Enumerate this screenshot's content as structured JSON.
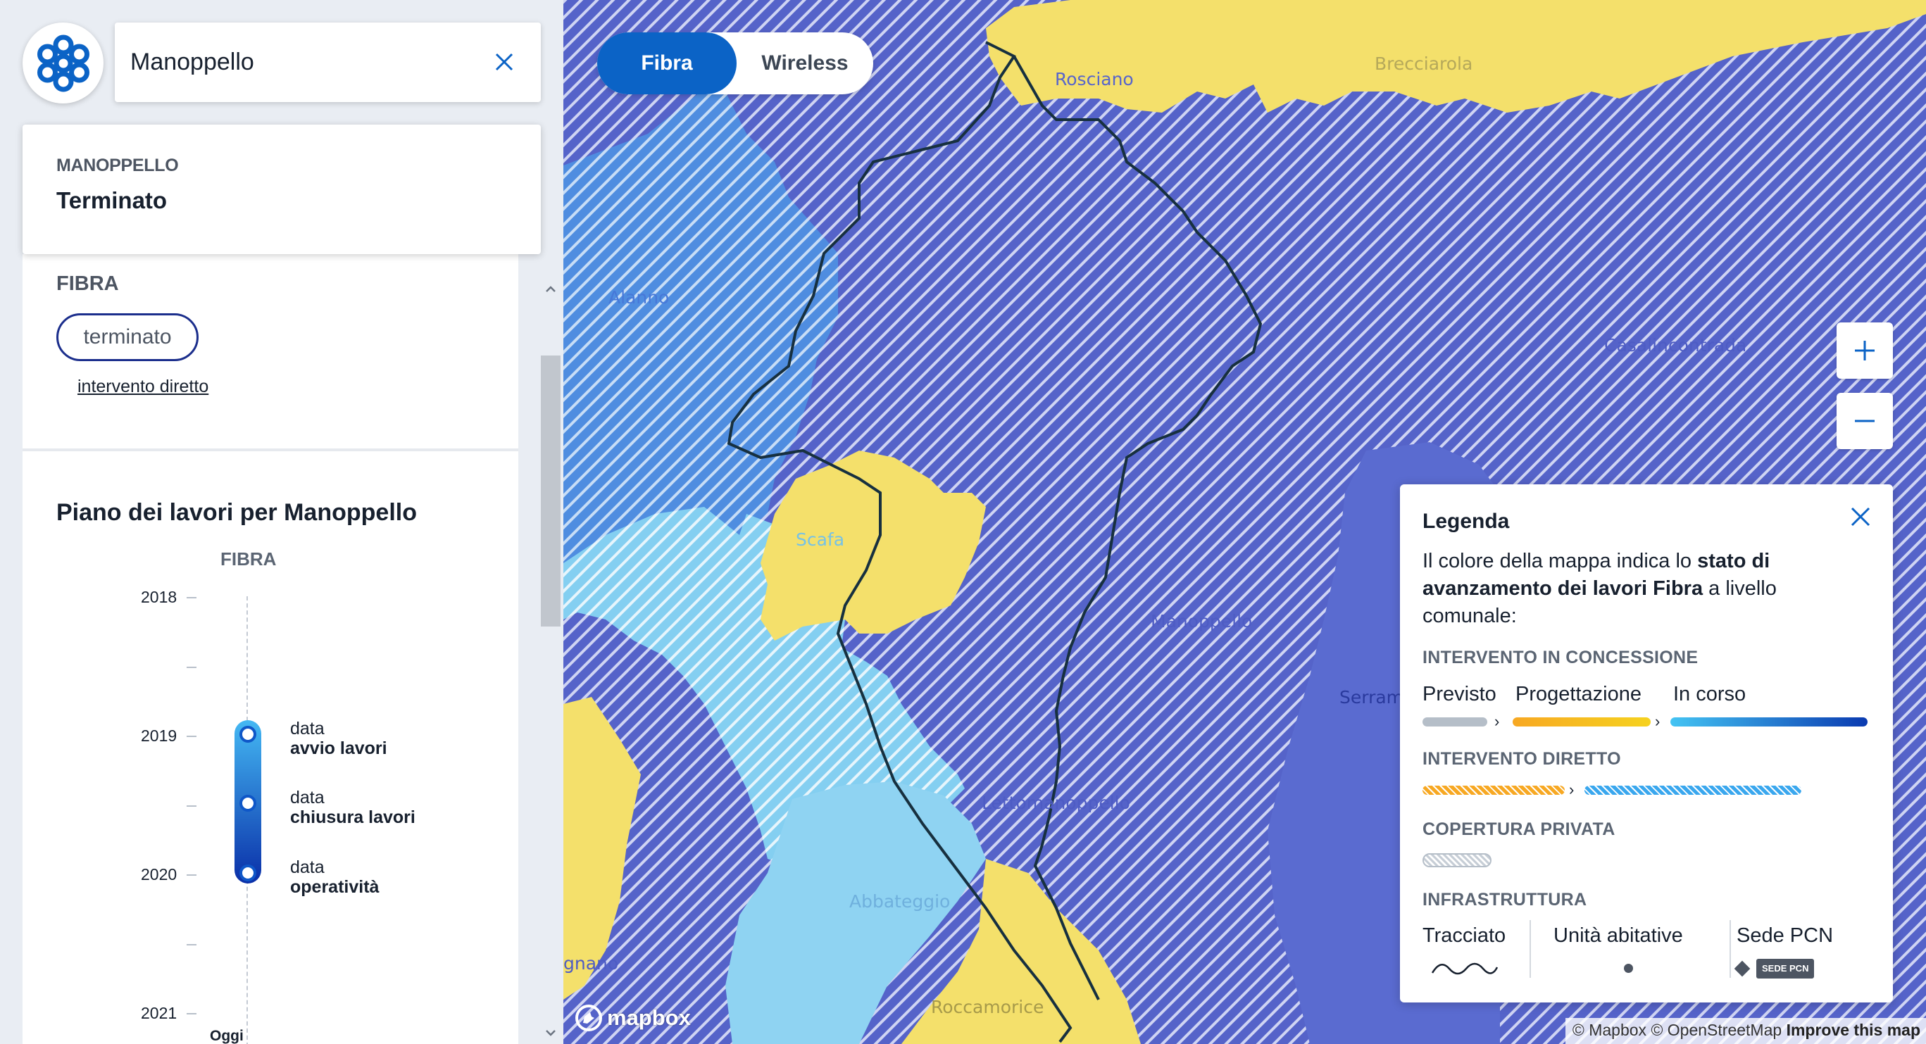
{
  "search": {
    "value": "Manoppello"
  },
  "result": {
    "name": "MANOPPELLO",
    "status": "Terminato"
  },
  "fibra_section": {
    "heading": "FIBRA",
    "status_pill": "terminato",
    "link": "intervento diretto"
  },
  "plan": {
    "title": "Piano dei lavori per Manoppello",
    "subtitle": "FIBRA",
    "years": [
      "2018",
      "2019",
      "2020",
      "2021"
    ],
    "today_label": "Oggi",
    "milestones": [
      {
        "line1": "data",
        "line2": "avvio lavori"
      },
      {
        "line1": "data",
        "line2": "chiusura lavori"
      },
      {
        "line1": "data",
        "line2": "operatività"
      }
    ]
  },
  "map_toggle": {
    "active": "Fibra",
    "inactive": "Wireless"
  },
  "map_labels": {
    "rosciano": "Rosciano",
    "brecciarola": "Brecciarola",
    "alanno": "Alanno",
    "casalincontrada": "Casalincontrada",
    "scafa": "Scafa",
    "manoppello": "Manoppello",
    "serramonacesca": "Serram",
    "lettomanoppello": "Lettomanoppello",
    "abbateggio": "Abbateggio",
    "roccamorice": "Roccamorice",
    "caramanico": "gnano"
  },
  "legend": {
    "title": "Legenda",
    "desc_pre": "Il colore della mappa indica lo ",
    "desc_bold1": "stato di avanzamento dei lavori Fibra",
    "desc_post": " a livello comunale:",
    "concessione_heading": "INTERVENTO IN CONCESSIONE",
    "stages": [
      "Previsto",
      "Progettazione",
      "In corso"
    ],
    "diretto_heading": "INTERVENTO DIRETTO",
    "privata_heading": "COPERTURA PRIVATA",
    "infra_heading": "INFRASTRUTTURA",
    "infra": [
      "Tracciato",
      "Unità abitative",
      "Sede PCN"
    ],
    "pcn_badge": "SEDE PCN"
  },
  "attribution": {
    "mapbox": "© Mapbox",
    "osm": "© OpenStreetMap",
    "improve": "Improve this map",
    "logo": "mapbox"
  },
  "colors": {
    "accent": "#0b63c6",
    "concession_dark": "#5a6bd0",
    "light_blue": "#8fd3f2",
    "yellow": "#f4e06b"
  }
}
